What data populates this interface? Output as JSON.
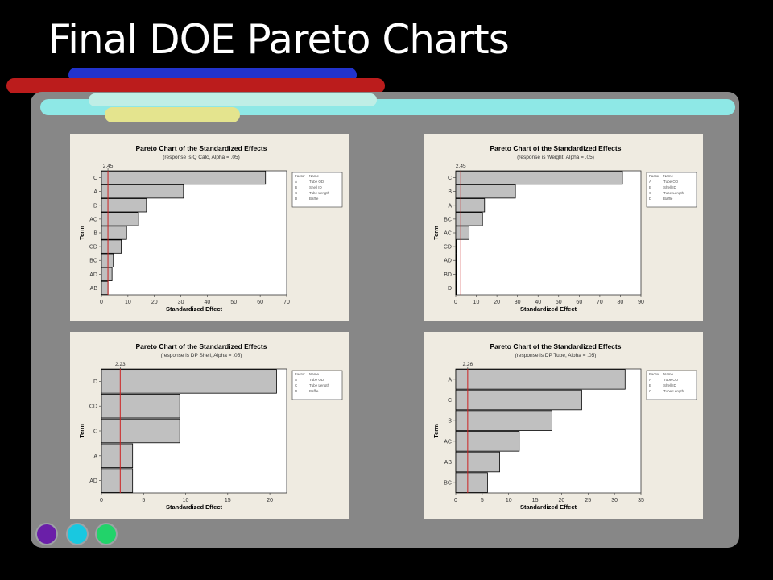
{
  "slide": {
    "title": "Final DOE Pareto Charts"
  },
  "colors": {
    "band1": "#2233cc",
    "band2": "#bb1c1c",
    "band3": "#8ee8e6",
    "band4": "#e4e48e",
    "panel": "#878787",
    "dot1": "#6a1fa8",
    "dot2": "#19c8e0",
    "dot3": "#22d36a",
    "chartBg": "#efebe1",
    "bar": "#c0c0c0",
    "refLine": "#cc2222"
  },
  "chart_data": [
    {
      "type": "bar",
      "orientation": "horizontal",
      "title": "Pareto Chart of the Standardized Effects",
      "subtitle": "(response is Q Calc, Alpha = .05)",
      "xlabel": "Standardized Effect",
      "ylabel": "Term",
      "categories": [
        "C",
        "A",
        "D",
        "AC",
        "B",
        "CD",
        "BC",
        "AD",
        "AB"
      ],
      "values": [
        62,
        31,
        17,
        14,
        9.5,
        7.5,
        4.5,
        4,
        2.5
      ],
      "xlim": [
        0,
        70
      ],
      "xticks": [
        0,
        10,
        20,
        30,
        40,
        50,
        60,
        70
      ],
      "reference": 2.45,
      "reference_label": "2.45",
      "legend": {
        "header": [
          "Factor",
          "Name"
        ],
        "rows": [
          [
            "A",
            "Tube OD"
          ],
          [
            "B",
            "Shell ID"
          ],
          [
            "C",
            "Tube Length"
          ],
          [
            "D",
            "Baffle"
          ]
        ]
      }
    },
    {
      "type": "bar",
      "orientation": "horizontal",
      "title": "Pareto Chart of the Standardized Effects",
      "subtitle": "(response is Weight, Alpha = .05)",
      "xlabel": "Standardized Effect",
      "ylabel": "Term",
      "categories": [
        "C",
        "B",
        "A",
        "BC",
        "AC",
        "CD",
        "AD",
        "BD",
        "D"
      ],
      "values": [
        81,
        29,
        14,
        13,
        6.5,
        0.3,
        0.3,
        0.3,
        0.3
      ],
      "xlim": [
        0,
        90
      ],
      "xticks": [
        0,
        10,
        20,
        30,
        40,
        50,
        60,
        70,
        80,
        90
      ],
      "reference": 2.45,
      "reference_label": "2.45",
      "legend": {
        "header": [
          "Factor",
          "Name"
        ],
        "rows": [
          [
            "A",
            "Tube OD"
          ],
          [
            "B",
            "Shell ID"
          ],
          [
            "C",
            "Tube Length"
          ],
          [
            "D",
            "Baffle"
          ]
        ]
      }
    },
    {
      "type": "bar",
      "orientation": "horizontal",
      "title": "Pareto Chart of the Standardized Effects",
      "subtitle": "(response is DP Shell, Alpha = .05)",
      "xlabel": "Standardized Effect",
      "ylabel": "Term",
      "categories": [
        "D",
        "CD",
        "C",
        "A",
        "AD"
      ],
      "values": [
        20.8,
        9.3,
        9.3,
        3.7,
        3.7
      ],
      "xlim": [
        0,
        22
      ],
      "xticks": [
        0,
        5,
        10,
        15,
        20
      ],
      "reference": 2.23,
      "reference_label": "2.23",
      "legend": {
        "header": [
          "Factor",
          "Name"
        ],
        "rows": [
          [
            "A",
            "Tube OD"
          ],
          [
            "C",
            "Tube Length"
          ],
          [
            "D",
            "Baffle"
          ]
        ]
      }
    },
    {
      "type": "bar",
      "orientation": "horizontal",
      "title": "Pareto Chart of the Standardized Effects",
      "subtitle": "(response is DP Tube, Alpha = .05)",
      "xlabel": "Standardized Effect",
      "ylabel": "Term",
      "categories": [
        "A",
        "C",
        "B",
        "AC",
        "AB",
        "BC"
      ],
      "values": [
        32,
        23.8,
        18.2,
        12,
        8.3,
        6
      ],
      "xlim": [
        0,
        35
      ],
      "xticks": [
        0,
        5,
        10,
        15,
        20,
        25,
        30,
        35
      ],
      "reference": 2.26,
      "reference_label": "2.26",
      "legend": {
        "header": [
          "Factor",
          "Name"
        ],
        "rows": [
          [
            "A",
            "Tube OD"
          ],
          [
            "B",
            "Shell ID"
          ],
          [
            "C",
            "Tube Length"
          ]
        ]
      }
    }
  ]
}
